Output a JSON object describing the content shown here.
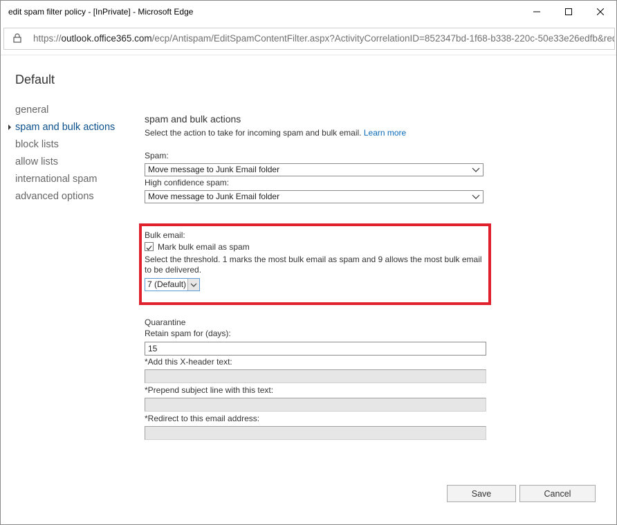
{
  "window": {
    "title": "edit spam filter policy - [InPrivate] - Microsoft Edge"
  },
  "address": {
    "prefix": "https://",
    "host": "outlook.office365.com",
    "path": "/ecp/Antispam/EditSpamContentFilter.aspx?ActivityCorrelationID=852347bd-1f68-b338-220c-50e33e26edfb&reqId="
  },
  "page": {
    "title": "Default"
  },
  "nav": {
    "items": [
      {
        "label": "general",
        "active": false
      },
      {
        "label": "spam and bulk actions",
        "active": true
      },
      {
        "label": "block lists",
        "active": false
      },
      {
        "label": "allow lists",
        "active": false
      },
      {
        "label": "international spam",
        "active": false
      },
      {
        "label": "advanced options",
        "active": false
      }
    ]
  },
  "section": {
    "title": "spam and bulk actions",
    "description": "Select the action to take for incoming spam and bulk email.",
    "learn_more": "Learn more"
  },
  "spam": {
    "label": "Spam:",
    "value": "Move message to Junk Email folder"
  },
  "high_confidence": {
    "label": "High confidence spam:",
    "value": "Move message to Junk Email folder"
  },
  "bulk": {
    "label": "Bulk email:",
    "checkbox_label": "Mark bulk email as spam",
    "checked": true,
    "threshold_line1": "Select the threshold. 1 marks the most bulk email as spam and 9 allows the most bulk email",
    "threshold_line2": "to be delivered.",
    "threshold_value": "7 (Default)"
  },
  "quarantine": {
    "label": "Quarantine",
    "retain_label": "Retain spam for (days):",
    "retain_value": "15",
    "xheader_label": "*Add this X-header text:",
    "prepend_label": "*Prepend subject line with this text:",
    "redirect_label": "*Redirect to this email address:"
  },
  "buttons": {
    "save": "Save",
    "cancel": "Cancel"
  },
  "colors": {
    "highlight": "#e0202c",
    "active_nav": "#0a4f8c",
    "link": "#0a6ab8"
  }
}
